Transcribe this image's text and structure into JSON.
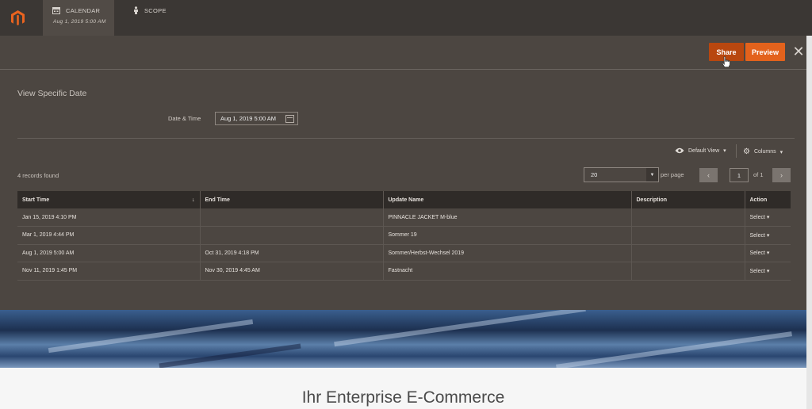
{
  "topbar": {
    "tabs": [
      {
        "label": "CALENDAR",
        "sub": "Aug 1, 2019 5:00 AM"
      },
      {
        "label": "SCOPE"
      }
    ]
  },
  "actions": {
    "share": "Share",
    "preview": "Preview",
    "close": "✕"
  },
  "panel": {
    "title": "View Specific Date",
    "date_label": "Date & Time",
    "date_value": "Aug 1, 2019 5:00 AM",
    "default_view": "Default View",
    "columns": "Columns",
    "records_found": "4 records found",
    "per_page_value": "20",
    "per_page_text": "per page",
    "page_value": "1",
    "page_of": "of 1"
  },
  "grid": {
    "headers": [
      "Start Time",
      "End Time",
      "Update Name",
      "Description",
      "Action"
    ],
    "rows": [
      {
        "start": "Jan 15, 2019 4:10 PM",
        "end": "",
        "name": "PINNACLE JACKET M-blue",
        "desc": "",
        "action": "Select"
      },
      {
        "start": "Mar 1, 2019 4:44 PM",
        "end": "",
        "name": "Sommer 19",
        "desc": "",
        "action": "Select"
      },
      {
        "start": "Aug 1, 2019 5:00 AM",
        "end": "Oct 31, 2019 4:18 PM",
        "name": "Sommer/Herbst-Wechsel 2019",
        "desc": "",
        "action": "Select"
      },
      {
        "start": "Nov 11, 2019 1:45 PM",
        "end": "Nov 30, 2019 4:45 AM",
        "name": "Fastnacht",
        "desc": "",
        "action": "Select"
      }
    ]
  },
  "page": {
    "heading": "Ihr Enterprise E-Commerce"
  },
  "colors": {
    "accent": "#e3621c",
    "share": "#b8470f",
    "panel": "#4c4641",
    "topbar": "#3b3734"
  }
}
